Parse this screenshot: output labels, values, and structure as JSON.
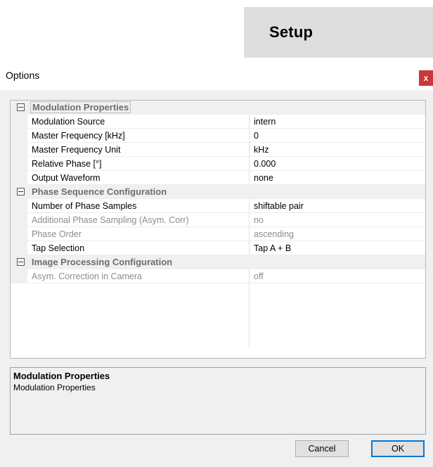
{
  "banner": {
    "title": "Setup"
  },
  "dialog": {
    "title": "Options",
    "close_label": "x"
  },
  "grid": {
    "categories": [
      {
        "name": "Modulation Properties",
        "properties": [
          {
            "name": "Modulation Source",
            "value": "intern",
            "enabled": true
          },
          {
            "name": "Master Frequency [kHz]",
            "value": "0",
            "enabled": true
          },
          {
            "name": "Master Frequency Unit",
            "value": "kHz",
            "enabled": true
          },
          {
            "name": "Relative Phase [°]",
            "value": "0.000",
            "enabled": true
          },
          {
            "name": "Output Waveform",
            "value": "none",
            "enabled": true
          }
        ]
      },
      {
        "name": "Phase Sequence Configuration",
        "properties": [
          {
            "name": "Number of Phase Samples",
            "value": "shiftable pair",
            "enabled": true
          },
          {
            "name": "Additional Phase Sampling (Asym. Corr)",
            "value": "no",
            "enabled": false
          },
          {
            "name": "Phase Order",
            "value": "ascending",
            "enabled": false
          },
          {
            "name": "Tap Selection",
            "value": "Tap A + B",
            "enabled": true
          }
        ]
      },
      {
        "name": "Image Processing Configuration",
        "properties": [
          {
            "name": "Asym. Correction in Camera",
            "value": "off",
            "enabled": false
          }
        ]
      }
    ]
  },
  "help": {
    "title": "Modulation Properties",
    "description": "Modulation Properties"
  },
  "buttons": {
    "cancel": "Cancel",
    "ok": "OK"
  }
}
